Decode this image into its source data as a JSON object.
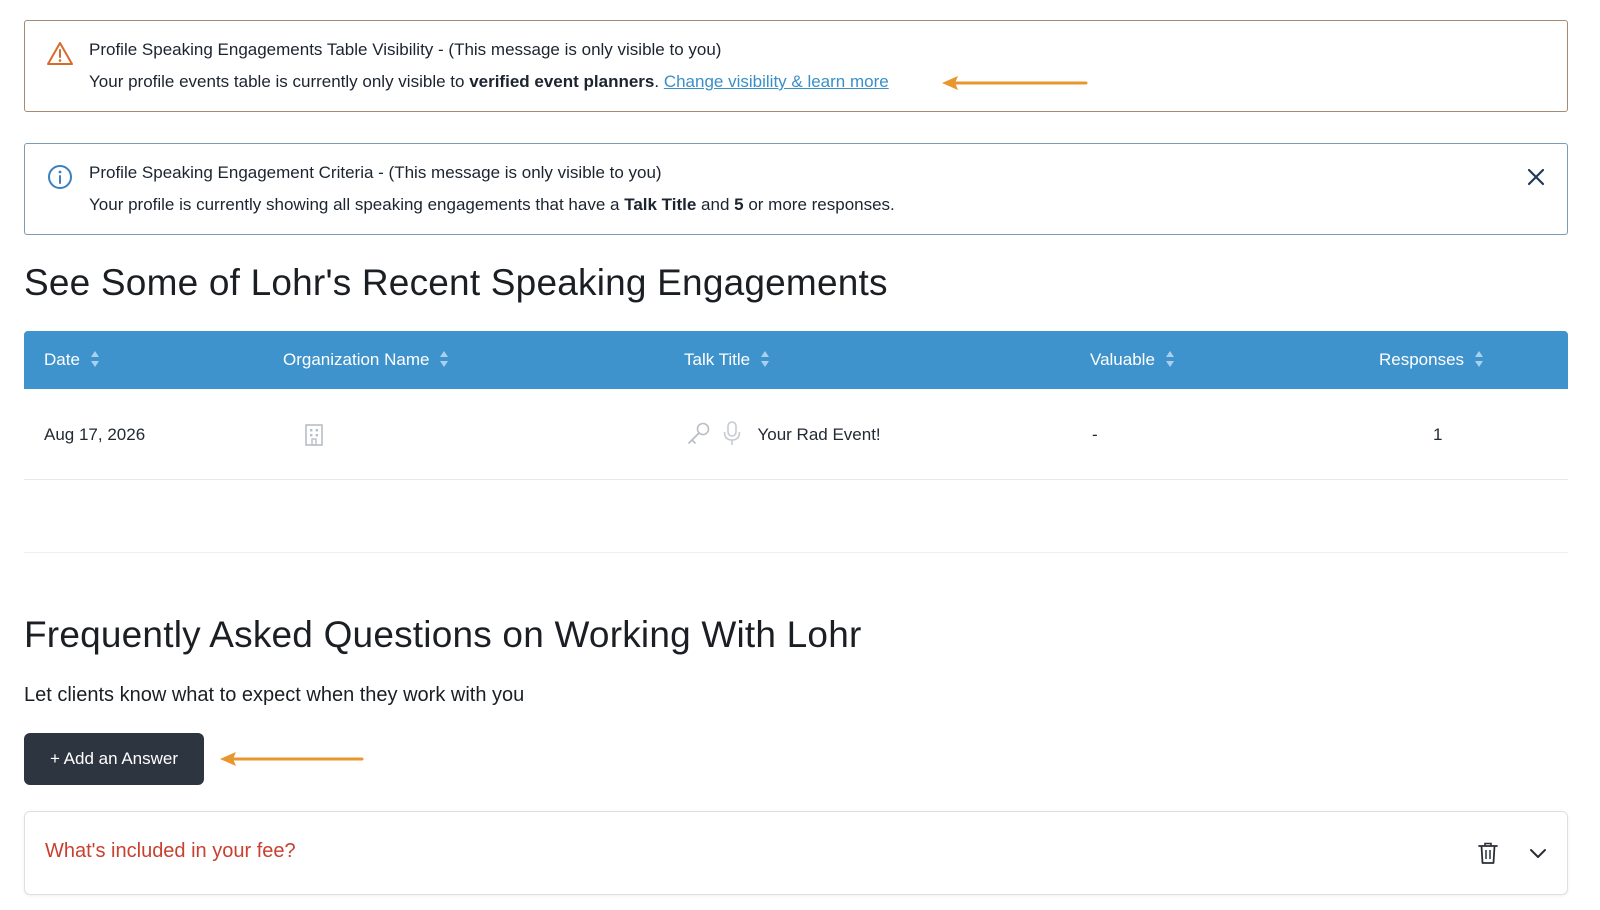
{
  "alerts": {
    "visibility": {
      "title": "Profile Speaking Engagements Table Visibility - (This message is only visible to you)",
      "text_before": "Your profile events table is currently only visible to ",
      "bold": "verified event planners",
      "text_after": ". ",
      "link": "Change visibility & learn more"
    },
    "criteria": {
      "title": "Profile Speaking Engagement Criteria - (This message is only visible to you)",
      "text_before": "Your profile is currently showing all speaking engagements that have a ",
      "bold1": "Talk Title",
      "text_mid": " and ",
      "bold2": "5",
      "text_after": " or more responses."
    }
  },
  "engagements": {
    "heading": "See Some of Lohr's Recent Speaking Engagements",
    "columns": [
      "Date",
      "Organization Name",
      "Talk Title",
      "Valuable",
      "Responses"
    ],
    "rows": [
      {
        "date": "Aug 17, 2026",
        "organization": "",
        "talk_title": "Your Rad Event!",
        "valuable": "-",
        "responses": "1"
      }
    ]
  },
  "faq": {
    "heading": "Frequently Asked Questions on Working With Lohr",
    "subtitle": "Let clients know what to expect when they work with you",
    "add_button": "+ Add an Answer",
    "items": [
      {
        "question": "What's included in your fee?"
      }
    ]
  },
  "colors": {
    "table_header": "#3f93cc",
    "warning_icon": "#d86a2b",
    "info_icon": "#3a7fc0",
    "link": "#3a8fc7",
    "annotation_arrow": "#e8962e",
    "button_bg": "#2d3540",
    "faq_question": "#c8402f"
  },
  "icons": {
    "warning": "warning-triangle-icon",
    "info": "info-circle-icon",
    "close": "close-icon",
    "sort": "sort-arrows-icon",
    "building": "building-icon",
    "key": "key-icon",
    "microphone": "microphone-icon",
    "trash": "trash-icon",
    "chevron": "chevron-down-icon"
  }
}
